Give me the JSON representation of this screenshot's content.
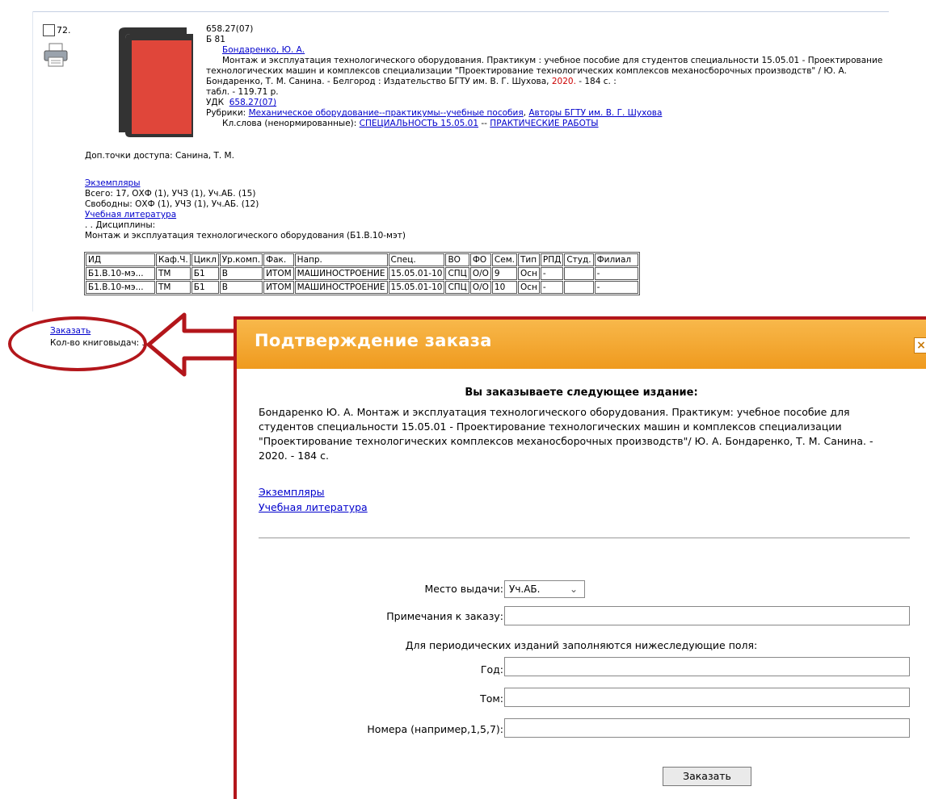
{
  "record": {
    "number": "72.",
    "classification": "658.27(07)",
    "author_mark": "Б 81",
    "author_link": "Бондаренко, Ю. А.",
    "description": "Монтаж и эксплуатация технологического оборудования. Практикум : учебное пособие для студентов специальности 15.05.01 - Проектирование технологических машин и комплексов специализации \"Проектирование технологических комплексов механосборочных производств\" / Ю. А. Бондаренко, Т. М. Санина. - Белгород : Издательство БГТУ им. В. Г. Шухова,",
    "year": "2020.",
    "pages": "- 184 с. :",
    "price": "табл. - 119.71 р.",
    "udk_label": "УДК",
    "udk_link": "658.27(07)",
    "rubrics_label": "Рубрики:",
    "rubric_1": "Механическое оборудование--практикумы--учебные пособия",
    "rubric_2": "Авторы БГТУ им. В. Г. Шухова",
    "keywords_label": "Кл.слова (ненормированные):",
    "keyword_1": "СПЕЦИАЛЬНОСТЬ 15.05.01",
    "keyword_sep": "--",
    "keyword_2": "ПРАКТИЧЕСКИЕ РАБОТЫ",
    "access_points": "Доп.точки доступа: Санина, Т. М.",
    "copies_link": "Экземпляры",
    "total": "Всего: 17, ОХФ (1), УЧЗ (1), Уч.АБ. (15)",
    "free": "Свободны: ОХФ (1), УЧЗ (1), Уч.АБ. (12)",
    "edu_lit_link": "Учебная литература",
    "disciplines_label": ". . Дисциплины:",
    "discipline": "Монтаж и эксплуатация технологического оборудования (Б1.В.10-мэт)",
    "order_link": "Заказать",
    "issues": "Кол-во книговыдач: 3"
  },
  "table": {
    "headers": [
      "ИД",
      "Каф.Ч.",
      "Цикл",
      "Ур.комп.",
      "Фак.",
      "Напр.",
      "Спец.",
      "ВО",
      "ФО",
      "Сем.",
      "Тип",
      "РПД",
      "Студ.",
      "Филиал"
    ],
    "rows": [
      [
        "Б1.В.10-мэ...",
        "ТМ",
        "Б1",
        "В",
        "ИТОМ",
        "МАШИНОСТРОЕНИЕ",
        "15.05.01-10",
        "СПЦ",
        "О/О",
        "9",
        "Осн",
        "-",
        "",
        "-"
      ],
      [
        "Б1.В.10-мэ...",
        "ТМ",
        "Б1",
        "В",
        "ИТОМ",
        "МАШИНОСТРОЕНИЕ",
        "15.05.01-10",
        "СПЦ",
        "О/О",
        "10",
        "Осн",
        "-",
        "",
        "-"
      ]
    ]
  },
  "dialog": {
    "title": "Подтверждение заказа",
    "close": "×",
    "heading": "Вы заказываете следующее издание:",
    "description": "Бондаренко Ю. А. Монтаж и эксплуатация технологического оборудования. Практикум: учебное пособие для студентов специальности 15.05.01 - Проектирование технологических машин и комплексов специализации \"Проектирование технологических комплексов механосборочных производств\"/ Ю. А. Бондаренко, Т. М. Санина. - 2020. - 184 с.",
    "link_copies": "Экземпляры",
    "link_edu": "Учебная литература",
    "place_label": "Место выдачи:",
    "place_value": "Уч.АБ.",
    "notes_label": "Примечания к заказу:",
    "periodic_note": "Для периодических изданий заполняются нижеследующие поля:",
    "year_label": "Год:",
    "volume_label": "Том:",
    "numbers_label": "Номера (например,1,5,7):",
    "submit": "Заказать"
  },
  "colors": {
    "accent_red": "#b3161b",
    "header_orange": "#f0a02a",
    "link_blue": "#0000cc",
    "book_red": "#e0463a",
    "book_dark": "#333333"
  }
}
